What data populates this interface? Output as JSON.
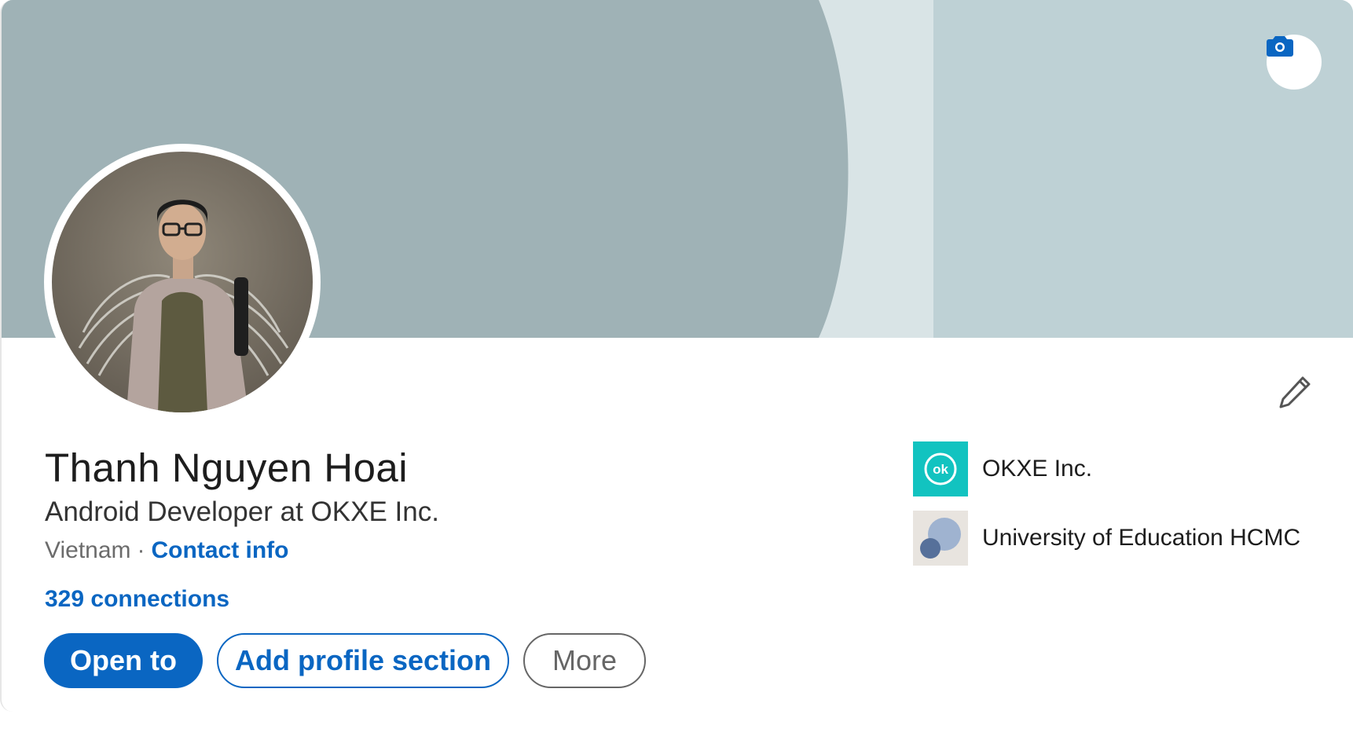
{
  "profile": {
    "name": "Thanh Nguyen Hoai",
    "headline": "Android Developer at OKXE Inc.",
    "location": "Vietnam",
    "separator": "·",
    "contact_info_label": "Contact info",
    "connections_label": "329 connections"
  },
  "actions": {
    "open_to_label": "Open to",
    "add_section_label": "Add profile section",
    "more_label": "More"
  },
  "organizations": [
    {
      "name": "OKXE Inc.",
      "logo_text": "ok",
      "logo_color": "#12c3c0"
    },
    {
      "name": "University of Education HCMC",
      "logo_color": "#e8e4df"
    }
  ],
  "banner": {
    "colors": [
      "#9fb2b6",
      "#d9e4e6",
      "#bed1d5"
    ]
  },
  "icons": {
    "camera": "camera-icon",
    "edit": "pencil-icon"
  },
  "theme": {
    "accent": "#0a66c2"
  }
}
